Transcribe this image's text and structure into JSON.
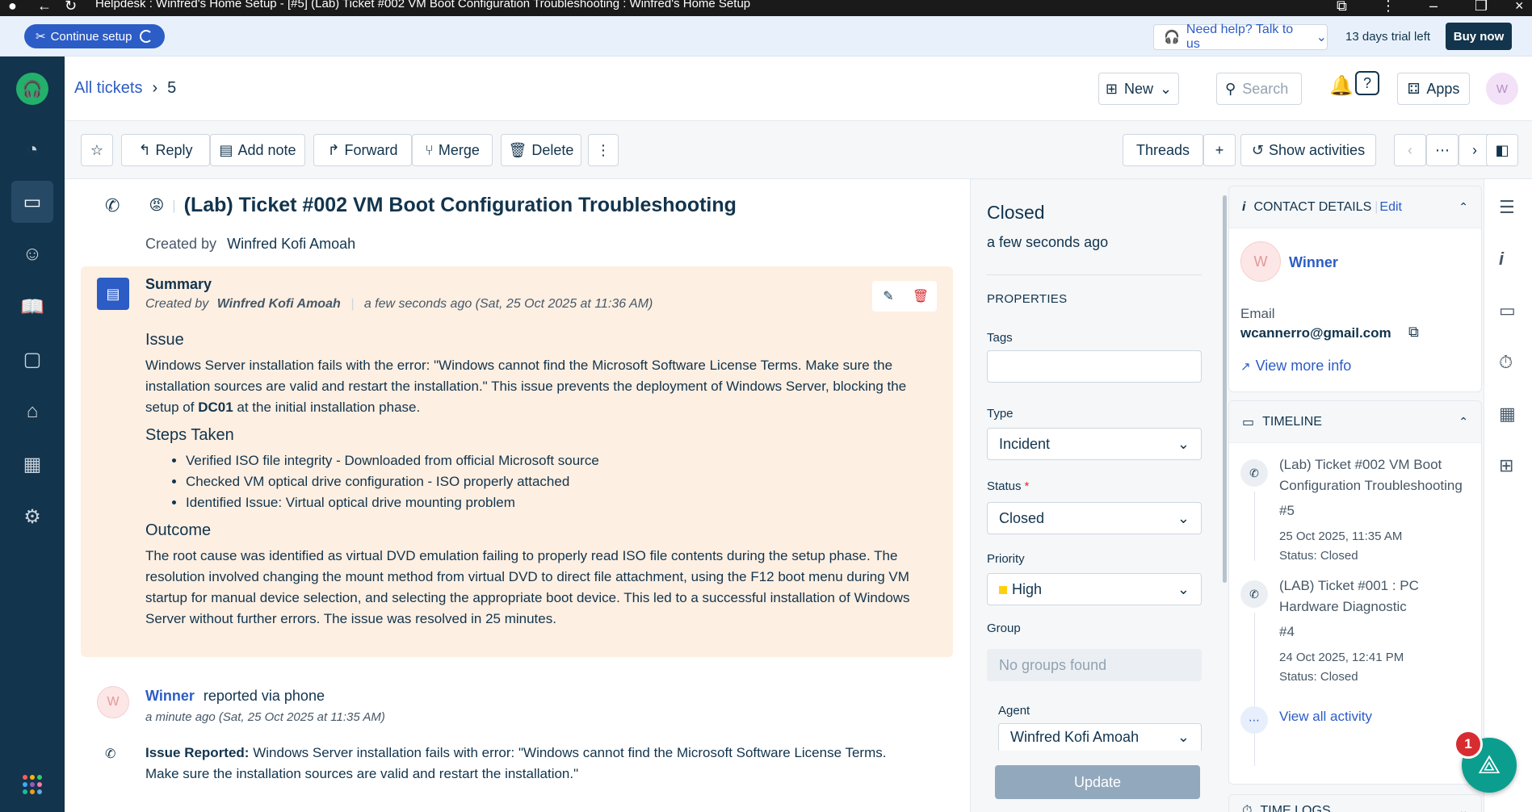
{
  "browser": {
    "title": "Helpdesk : Winfred's Home Setup - [#5] (Lab) Ticket #002 VM Boot Configuration Troubleshooting : Winfred's Home Setup"
  },
  "setup_bar": {
    "continue_label": "Continue setup",
    "help_label": "Need help? Talk to us",
    "trial_text": "13 days trial left",
    "buy_label": "Buy now"
  },
  "header": {
    "breadcrumb_link": "All tickets",
    "breadcrumb_current": "5",
    "new_label": "New",
    "search_placeholder": "Search",
    "apps_label": "Apps",
    "avatar_initial": "W"
  },
  "toolbar": {
    "reply": "Reply",
    "add_note": "Add note",
    "forward": "Forward",
    "merge": "Merge",
    "delete": "Delete",
    "threads": "Threads",
    "show_activities": "Show activities"
  },
  "ticket": {
    "title": "(Lab) Ticket #002 VM Boot Configuration Troubleshooting",
    "created_by_label": "Created by",
    "created_by": "Winfred Kofi Amoah"
  },
  "summary": {
    "title": "Summary",
    "meta_label": "Created by",
    "meta_author": "Winfred Kofi Amoah",
    "meta_time": "a few seconds ago (Sat, 25 Oct 2025 at 11:36 AM)",
    "issue_heading": "Issue",
    "issue_text_1": "Windows Server installation fails with the error: \"Windows cannot find the Microsoft Software License Terms. Make sure the installation sources are valid and restart the installation.\" This issue prevents the deployment of Windows Server, blocking the setup of ",
    "issue_bold": "DC01",
    "issue_text_2": " at the initial installation phase.",
    "steps_heading": "Steps Taken",
    "steps": [
      "Verified ISO file integrity - Downloaded from official Microsoft source",
      "Checked VM optical drive configuration - ISO properly attached",
      "Identified Issue: Virtual optical drive mounting problem"
    ],
    "outcome_heading": "Outcome",
    "outcome_text": "The root cause was identified as virtual DVD emulation failing to properly read ISO file contents during the setup phase. The resolution involved changing the mount method from virtual DVD to direct file attachment, using the F12 boot menu during VM startup for manual device selection, and selecting the appropriate boot device. This led to a successful installation of Windows Server without further errors. The issue was resolved in 25 minutes."
  },
  "conversation": {
    "avatar_initial": "W",
    "reporter": "Winner",
    "via": "reported via phone",
    "time": "a minute ago (Sat, 25 Oct 2025 at 11:35 AM)",
    "msg_label": "Issue Reported:",
    "msg_text": " Windows Server installation fails with error: \"Windows cannot find the Microsoft Software License Terms. Make sure the installation sources are valid and restart the installation.\""
  },
  "properties": {
    "status_big": "Closed",
    "status_time": "a few seconds ago",
    "heading": "PROPERTIES",
    "tags_label": "Tags",
    "type_label": "Type",
    "type_value": "Incident",
    "status_label": "Status",
    "status_req": "*",
    "status_value": "Closed",
    "priority_label": "Priority",
    "priority_value": "High",
    "group_label": "Group",
    "group_value": "No groups found",
    "agent_label": "Agent",
    "agent_value": "Winfred Kofi Amoah",
    "update_label": "Update"
  },
  "contact": {
    "heading": "CONTACT DETAILS",
    "edit_label": "Edit",
    "avatar_initial": "W",
    "name": "Winner",
    "email_label": "Email",
    "email": "wcannerro@gmail.com",
    "view_more": "View more info"
  },
  "timeline": {
    "heading": "TIMELINE",
    "items": [
      {
        "title": "(Lab) Ticket #002 VM Boot Configuration Troubleshooting",
        "id": "#5",
        "date": "25 Oct 2025, 11:35 AM",
        "status": "Status: Closed"
      },
      {
        "title": "(LAB) Ticket #001 : PC Hardware Diagnostic",
        "id": "#4",
        "date": "24 Oct 2025, 12:41 PM",
        "status": "Status: Closed"
      }
    ],
    "view_all": "View all activity"
  },
  "time_logs": {
    "heading": "TIME LOGS"
  },
  "fab": {
    "badge": "1"
  },
  "colors": {
    "primary": "#2c5cc5",
    "nav_bg": "#12344d",
    "summary_bg": "#fdefe2",
    "priority_high": "#ffd012"
  }
}
